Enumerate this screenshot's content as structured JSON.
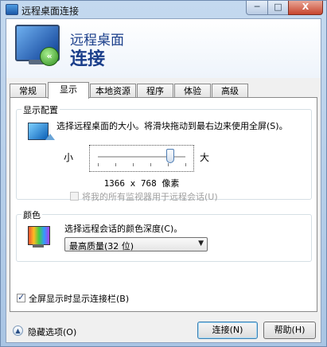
{
  "window": {
    "title": "远程桌面连接",
    "controls": {
      "minimize": "─",
      "maximize": "□",
      "close": "X"
    }
  },
  "header": {
    "line1": "远程桌面",
    "line2": "连接",
    "badge": "«"
  },
  "tabs": [
    {
      "label": "常规",
      "active": false
    },
    {
      "label": "显示",
      "active": true
    },
    {
      "label": "本地资源",
      "active": false
    },
    {
      "label": "程序",
      "active": false
    },
    {
      "label": "体验",
      "active": false
    },
    {
      "label": "高级",
      "active": false
    }
  ],
  "display_config": {
    "legend": "显示配置",
    "description": "选择远程桌面的大小。将滑块拖动到最右边来使用全屏(S)。",
    "small_label": "小",
    "large_label": "大",
    "slider_value": 0.83,
    "resolution": "1366 x 768 像素",
    "all_monitors_label": "将我的所有监视器用于远程会话(U)",
    "all_monitors_checked": false,
    "all_monitors_enabled": false
  },
  "colors": {
    "legend": "颜色",
    "description": "选择远程会话的颜色深度(C)。",
    "depth_selected": "最高质量(32 位)",
    "dropdown_arrow": "▼"
  },
  "fullscreen_bar": {
    "label": "全屏显示时显示连接栏(B)",
    "checked": true
  },
  "footer": {
    "hide_options": "隐藏选项(O)",
    "chevron": "▲",
    "connect_button": "连接(N)",
    "help_button": "帮助(H)"
  }
}
